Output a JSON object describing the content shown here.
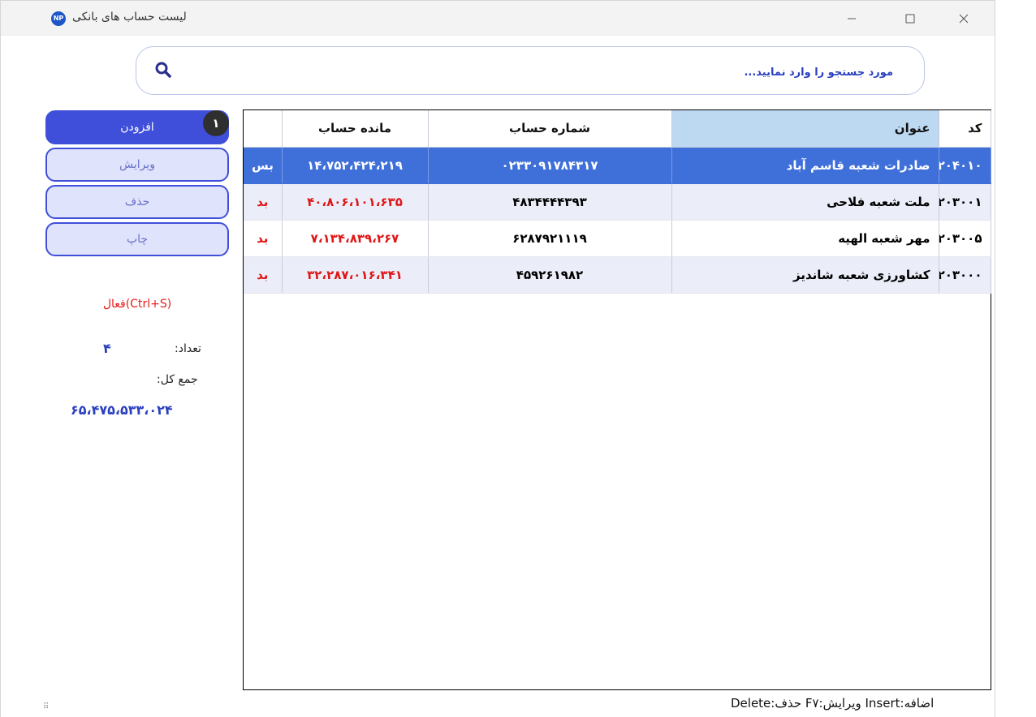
{
  "window": {
    "title": "لیست حساب های بانکی",
    "icon_name": "app-logo-icon"
  },
  "search": {
    "placeholder": "مورد جستجو را وارد نمایید..."
  },
  "actions": {
    "add_label": "افزودن",
    "edit_label": "ویرایش",
    "delete_label": "حذف",
    "print_label": "چاپ",
    "badge": "۱"
  },
  "summary": {
    "active_label": "فعال(Ctrl+S)",
    "count_label": "تعداد:",
    "count_value": "۴",
    "total_label": "جمع کل:",
    "total_value": "۶۵،۴۷۵،۵۳۳،۰۲۴"
  },
  "table": {
    "headers": {
      "code": "کد",
      "title": "عنوان",
      "account": "شماره حساب",
      "balance": "مانده حساب",
      "flag": ""
    },
    "rows": [
      {
        "code": "۲۰۴۰۱۰",
        "title": "صادرات شعبه قاسم آباد",
        "account": "۰۲۳۳۰۹۱۷۸۴۳۱۷",
        "balance": "۱۴،۷۵۲،۴۲۴،۲۱۹",
        "flag": "بس"
      },
      {
        "code": "۲۰۳۰۰۱",
        "title": "ملت شعبه فلاحی",
        "account": "۴۸۳۴۴۴۴۳۹۳",
        "balance": "۴۰،۸۰۶،۱۰۱،۶۳۵",
        "flag": "بد"
      },
      {
        "code": "۲۰۳۰۰۵",
        "title": "مهر شعبه الهیه",
        "account": "۶۲۸۷۹۲۱۱۱۹",
        "balance": "۷،۱۳۴،۸۳۹،۲۶۷",
        "flag": "بد"
      },
      {
        "code": "۲۰۳۰۰۰",
        "title": "کشاورزی شعبه شاندیز",
        "account": "۴۵۹۲۶۱۹۸۲",
        "balance": "۳۲،۲۸۷،۰۱۶،۳۴۱",
        "flag": "بد"
      }
    ]
  },
  "status_bar": {
    "text": "اضافه:Insert   ویرایش:F۷   حذف:Delete"
  },
  "colors": {
    "primary": "#3f4fd9",
    "selected_row": "#3f6fd9",
    "negative": "#e01616",
    "accent_text": "#2a3fbf"
  }
}
